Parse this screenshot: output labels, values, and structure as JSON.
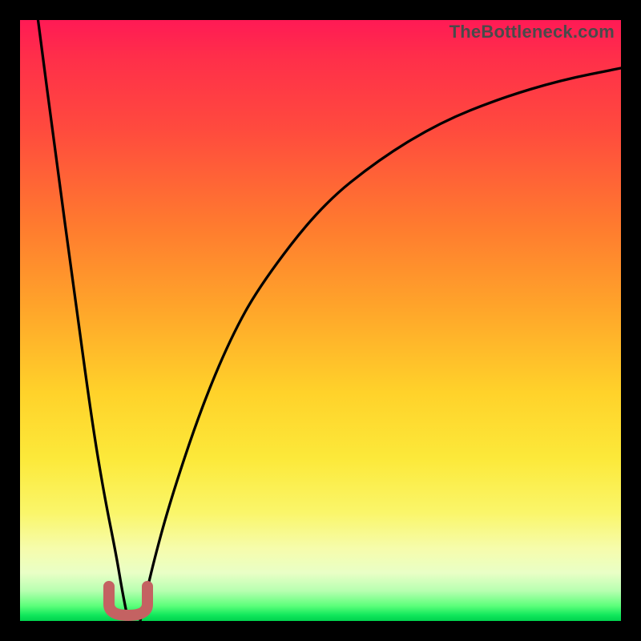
{
  "attribution": "TheBottleneck.com",
  "chart_data": {
    "type": "line",
    "title": "",
    "xlabel": "",
    "ylabel": "",
    "xlim": [
      0,
      100
    ],
    "ylim": [
      0,
      100
    ],
    "grid": false,
    "legend": false,
    "annotations": [
      {
        "name": "u-marker",
        "x": 18,
        "y": 2,
        "color": "#c46262"
      }
    ],
    "series": [
      {
        "name": "left-branch",
        "x": [
          3,
          6,
          9,
          12,
          14,
          16,
          17,
          18
        ],
        "values": [
          100,
          77,
          55,
          33,
          21,
          11,
          5,
          0
        ]
      },
      {
        "name": "right-branch",
        "x": [
          20,
          22,
          25,
          30,
          35,
          40,
          50,
          60,
          70,
          80,
          90,
          100
        ],
        "values": [
          0,
          9,
          20,
          35,
          47,
          56,
          69,
          77,
          83,
          87,
          90,
          92
        ]
      }
    ],
    "background_gradient": {
      "direction": "top-to-bottom",
      "stops": [
        {
          "pos": 0.0,
          "color": "#ff1a55"
        },
        {
          "pos": 0.18,
          "color": "#ff4a3e"
        },
        {
          "pos": 0.48,
          "color": "#ffa52a"
        },
        {
          "pos": 0.73,
          "color": "#fce93a"
        },
        {
          "pos": 0.92,
          "color": "#e9ffc6"
        },
        {
          "pos": 1.0,
          "color": "#00d24e"
        }
      ]
    }
  }
}
